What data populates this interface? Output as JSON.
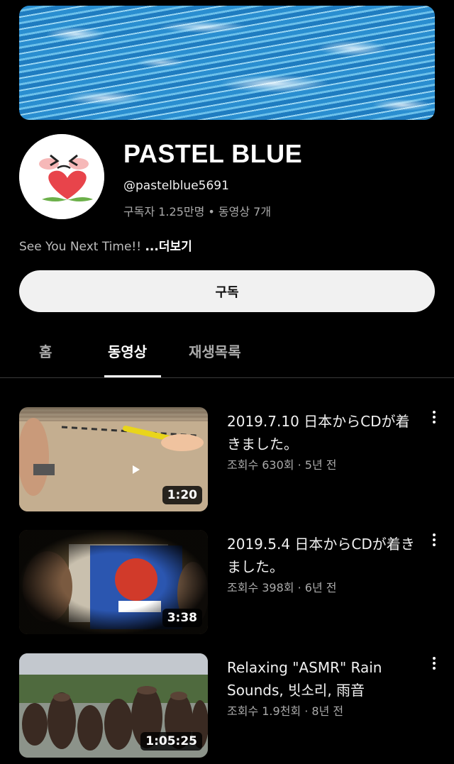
{
  "channel": {
    "name": "PASTEL BLUE",
    "handle": "@pastelblue5691",
    "stats": "구독자 1.25만명 • 동영상 7개",
    "description": "See You Next Time!!",
    "more_label": "...더보기",
    "subscribe_label": "구독"
  },
  "tabs": [
    {
      "label": "홈"
    },
    {
      "label": "동영상"
    },
    {
      "label": "재생목록"
    }
  ],
  "videos": [
    {
      "title": "2019.7.10 日本からCDが着きました。",
      "meta": "조회수 630회 · 5년 전",
      "duration": "1:20"
    },
    {
      "title": "2019.5.4 日本からCDが着きました。",
      "meta": "조회수 398회 · 6년 전",
      "duration": "3:38"
    },
    {
      "title": "Relaxing \"ASMR\" Rain Sounds, 빗소리, 雨音",
      "meta": "조회수 1.9천회 · 8년 전",
      "duration": "1:05:25"
    }
  ],
  "colors": {
    "background": "#000000",
    "subscribe_bg": "#f1f1f1",
    "muted_text": "#aaaaaa"
  }
}
